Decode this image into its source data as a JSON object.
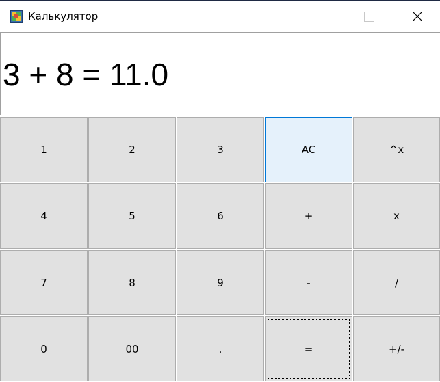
{
  "window": {
    "title": "Калькулятор",
    "icon": "calculator-app-icon",
    "controls": [
      "minimize-icon",
      "maximize-icon",
      "close-icon"
    ]
  },
  "display": {
    "expression": "3 + 8 = 11.0"
  },
  "keypad": {
    "rows": [
      [
        "1",
        "2",
        "3",
        "AC",
        "^x"
      ],
      [
        "4",
        "5",
        "6",
        "+",
        "x"
      ],
      [
        "7",
        "8",
        "9",
        "-",
        "/"
      ],
      [
        "0",
        "00",
        ".",
        "=",
        "+/-"
      ]
    ],
    "hovered_key": "AC",
    "focused_key": "="
  },
  "colors": {
    "button_face": "#e1e1e1",
    "button_border": "#adadad",
    "hover_face": "#e5f1fb",
    "hover_border": "#0078d7"
  }
}
